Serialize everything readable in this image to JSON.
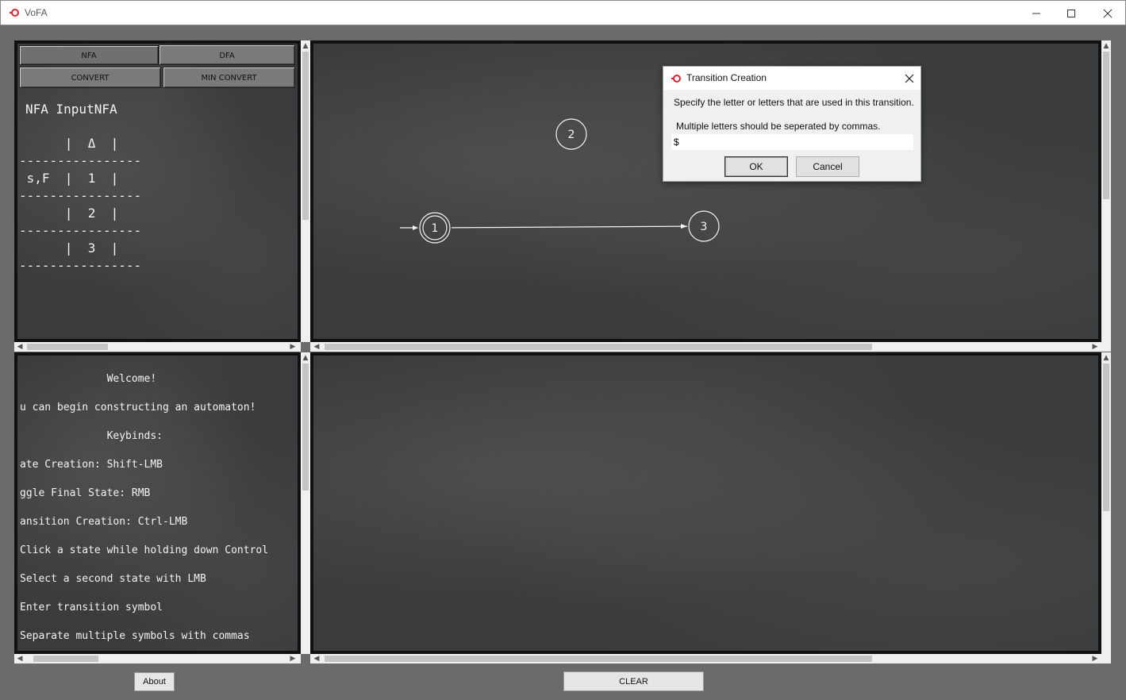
{
  "window": {
    "title": "VoFA"
  },
  "toolbar": {
    "nfa_label": "NFA",
    "dfa_label": "DFA",
    "convert_label": "CONVERT",
    "min_convert_label": "MIN CONVERT"
  },
  "table_panel": {
    "title": "NFA InputNFA",
    "lines": [
      "      |  Δ  |",
      "----------------",
      " s,F  |  1  |",
      "----------------",
      "      |  2  |",
      "----------------",
      "      |  3  |",
      "----------------"
    ]
  },
  "console_panel": {
    "lines": [
      "              Welcome!",
      "u can begin constructing an automaton!",
      "              Keybinds:",
      "ate Creation: Shift-LMB",
      "ggle Final State: RMB",
      "ansition Creation: Ctrl-LMB",
      "Click a state while holding down Control",
      "Select a second state with LMB",
      "Enter transition symbol",
      "Separate multiple symbols with commas"
    ]
  },
  "canvas": {
    "states": [
      {
        "label": "1",
        "start": true,
        "final": true
      },
      {
        "label": "2",
        "start": false,
        "final": false
      },
      {
        "label": "3",
        "start": false,
        "final": false
      }
    ],
    "transitions": [
      {
        "from": "1",
        "to": "3"
      }
    ]
  },
  "dialog": {
    "title": "Transition Creation",
    "line1": "Specify the letter or letters that are used in this transition.",
    "line2": "Multiple letters should be seperated by commas.",
    "input_value": "$",
    "ok_label": "OK",
    "cancel_label": "Cancel"
  },
  "footer": {
    "about_label": "About",
    "clear_label": "CLEAR"
  },
  "colors": {
    "board": "#393b3c",
    "chalk": "#f3f3f3",
    "frame": "#6b6b6b",
    "accent_red": "#d9232e"
  }
}
